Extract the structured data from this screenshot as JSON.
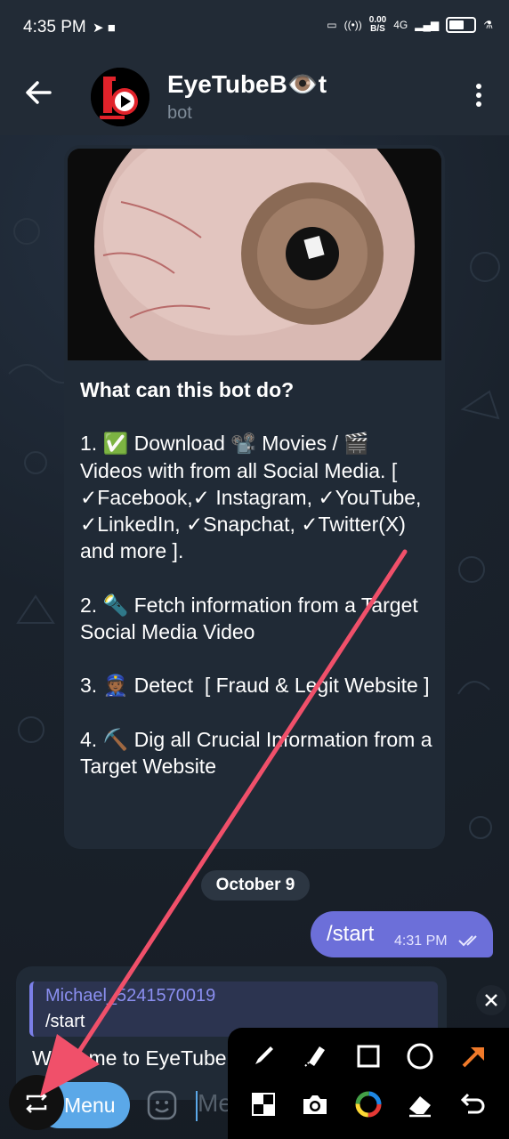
{
  "status_bar": {
    "time": "4:35 PM",
    "net_speed_value": "0.00",
    "net_speed_unit": "B/S",
    "network": "4G"
  },
  "header": {
    "title": "EyeTubeB👁️t",
    "subtitle": "bot"
  },
  "bot_card": {
    "heading": "What can this bot do?",
    "item1": "1. ✅ Download 📽️ Movies / 🎬 Videos with from all Social Media. [ ✓Facebook,✓ Instagram, ✓YouTube, ✓LinkedIn, ✓Snapchat, ✓Twitter(X) and more ].",
    "item2": "2. 🔦 Fetch information from a Target Social Media Video",
    "item3": "3. 👮🏾 Detect  [ Fraud & Legit Website ]",
    "item4": "4. ⛏️ Dig all Crucial Information from a Target Website"
  },
  "date_separator": "October 9",
  "outgoing": {
    "text": "/start",
    "time": "4:31 PM"
  },
  "incoming": {
    "reply_name": "Michael_5241570019",
    "reply_text": "/start",
    "text": "Welcome to EyeTubeB👁️t. Underdur"
  },
  "bottom": {
    "menu_label": "Menu",
    "input_placeholder": "Message"
  },
  "colors": {
    "accent": "#6c6fd9",
    "menu": "#5ba8e8",
    "annotation_arrow": "#f0506a",
    "tool_arrow": "#f07a2a"
  },
  "toolbar_icons": [
    "pen-icon",
    "highlighter-icon",
    "rectangle-icon",
    "circle-icon",
    "arrow-icon",
    "mosaic-icon",
    "camera-icon",
    "color-picker-icon",
    "eraser-icon",
    "undo-icon"
  ]
}
